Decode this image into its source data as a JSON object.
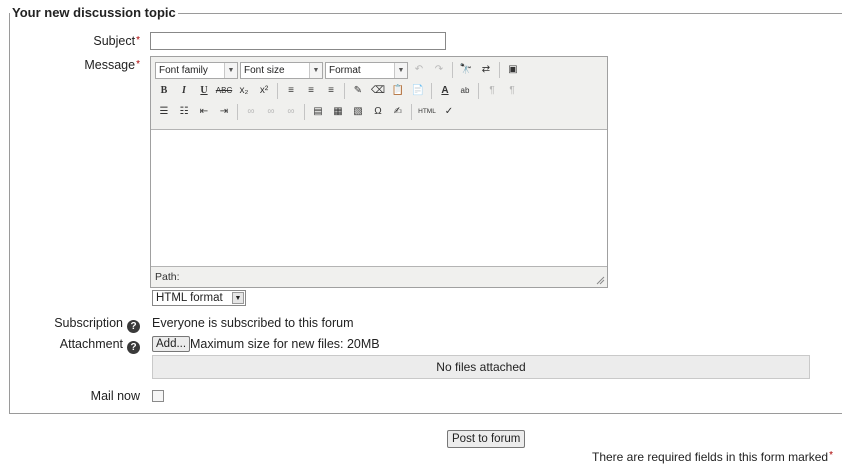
{
  "form": {
    "legend": "Your new discussion topic",
    "subject_label": "Subject",
    "message_label": "Message",
    "required_marker": "*",
    "subject_value": "",
    "editor": {
      "font_family": "Font family",
      "font_size": "Font size",
      "format": "Format",
      "path_label": "Path:",
      "toolbar_row2": [
        "B",
        "I",
        "U",
        "ABC",
        "x₂",
        "x²"
      ],
      "toolbar_row3_text": "HTML"
    },
    "format_select": "HTML format",
    "subscription_label": "Subscription",
    "subscription_value": "Everyone is subscribed to this forum",
    "attachment_label": "Attachment",
    "add_button": "Add...",
    "max_size_text": "Maximum size for new files: 20MB",
    "no_files_text": "No files attached",
    "mail_now_label": "Mail now",
    "mail_now_checked": false
  },
  "post_button": "Post to forum",
  "required_note": "There are required fields in this form marked"
}
